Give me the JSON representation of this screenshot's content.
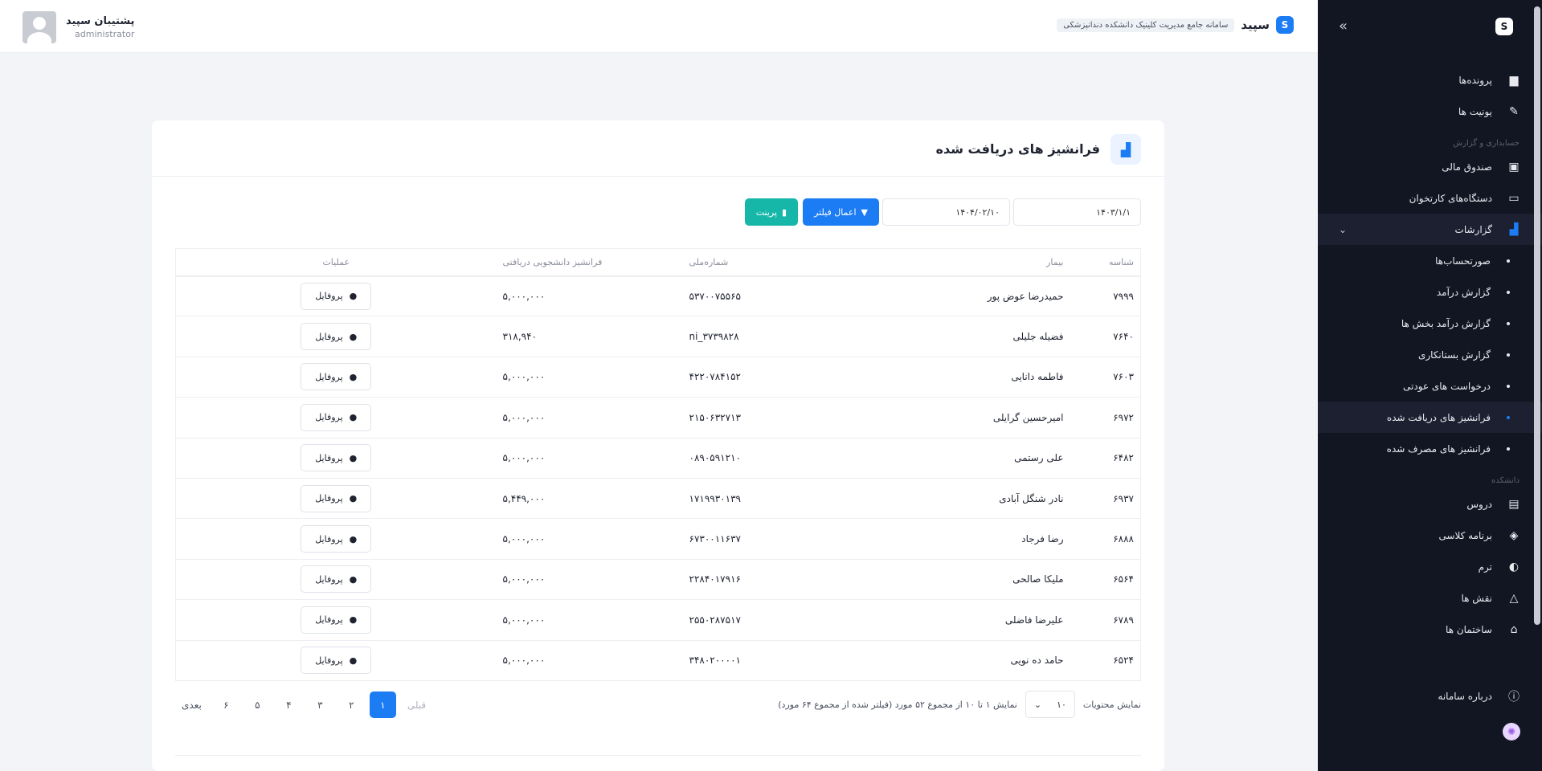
{
  "topbar": {
    "brand_name": "سپید",
    "brand_tag": "سامانه جامع مدیریت کلینیک دانشکده دندانپزشکی",
    "user_name": "پشتیبان سپید",
    "user_role": "administrator"
  },
  "sidebar": {
    "logo": "S",
    "collapse": "»",
    "items_top": [
      {
        "label": "پرونده‌ها",
        "icon": "folder-icon"
      },
      {
        "label": "یونیت ها",
        "icon": "tooth-tool-icon"
      }
    ],
    "section_accounting": "حسابداری و گزارش",
    "items_accounting": [
      {
        "label": "صندوق مالی",
        "icon": "cashbox-icon"
      },
      {
        "label": "دستگاه‌های کارتخوان",
        "icon": "card-icon"
      },
      {
        "label": "گزارشات",
        "icon": "chart-icon"
      }
    ],
    "sub_items": [
      {
        "label": "صورتحساب‌ها"
      },
      {
        "label": "گزارش درآمد"
      },
      {
        "label": "گزارش درآمد بخش ها"
      },
      {
        "label": "گزارش بستانکاری"
      },
      {
        "label": "درخواست های عودتی"
      },
      {
        "label": "فرانشیز های دریافت شده"
      },
      {
        "label": "فرانشیز های مصرف شده"
      }
    ],
    "section_university": "دانشکده",
    "items_university": [
      {
        "label": "دروس",
        "icon": "book-icon"
      },
      {
        "label": "برنامه کلاسی",
        "icon": "layers-icon"
      },
      {
        "label": "ترم",
        "icon": "toggle-icon"
      },
      {
        "label": "نقش ها",
        "icon": "shapes-icon"
      },
      {
        "label": "ساختمان ها",
        "icon": "building-icon"
      }
    ],
    "item_about": {
      "label": "درباره سامانه",
      "icon": "info-icon"
    }
  },
  "card": {
    "title": "فرانشیز های دریافت شده",
    "from_date": "۱۴۰۳/۱/۱",
    "to_date": "۱۴۰۴/۰۲/۱۰",
    "apply_filter": "اعمال فیلتر",
    "print": "پرینت"
  },
  "table": {
    "headers": {
      "id": "شناسه",
      "patient": "بیمار",
      "national_id": "شماره‌ملی",
      "franchise": "فرانشیز دانشجویی دریافتی",
      "actions": "عملیات"
    },
    "profile_label": "پروفایل",
    "rows": [
      {
        "id": "۷۹۹۹",
        "patient": "حمیدرضا عوض پور",
        "national_id": "۵۳۷۰۰۷۵۵۶۵",
        "franchise": "۵,۰۰۰,۰۰۰"
      },
      {
        "id": "۷۶۴۰",
        "patient": "فضیله جلیلی",
        "national_id": "ni_۳۷۳۹۸۲۸",
        "franchise": "۳۱۸,۹۴۰"
      },
      {
        "id": "۷۶۰۳",
        "patient": "فاطمه دانایی",
        "national_id": "۴۲۲۰۷۸۴۱۵۲",
        "franchise": "۵,۰۰۰,۰۰۰"
      },
      {
        "id": "۶۹۷۲",
        "patient": "امیرحسین گرایلی",
        "national_id": "۲۱۵۰۶۳۲۷۱۳",
        "franchise": "۵,۰۰۰,۰۰۰"
      },
      {
        "id": "۶۴۸۲",
        "patient": "علی رستمی",
        "national_id": "۰۸۹۰۵۹۱۲۱۰",
        "franchise": "۵,۰۰۰,۰۰۰"
      },
      {
        "id": "۶۹۳۷",
        "patient": "نادر شنگل آبادی",
        "national_id": "۱۷۱۹۹۳۰۱۳۹",
        "franchise": "۵,۴۴۹,۰۰۰"
      },
      {
        "id": "۶۸۸۸",
        "patient": "رضا فرجاد",
        "national_id": "۶۷۳۰۰۱۱۶۳۷",
        "franchise": "۵,۰۰۰,۰۰۰"
      },
      {
        "id": "۶۵۶۴",
        "patient": "ملیکا صالحی",
        "national_id": "۲۲۸۴۰۱۷۹۱۶",
        "franchise": "۵,۰۰۰,۰۰۰"
      },
      {
        "id": "۶۷۸۹",
        "patient": "علیرضا فاضلی",
        "national_id": "۲۵۵۰۲۸۷۵۱۷",
        "franchise": "۵,۰۰۰,۰۰۰"
      },
      {
        "id": "۶۵۲۴",
        "patient": "حامد ده نویی",
        "national_id": "۳۴۸۰۲۰۰۰۰۱",
        "franchise": "۵,۰۰۰,۰۰۰"
      }
    ]
  },
  "pagination": {
    "show_label": "نمایش محتویات",
    "page_size": "۱۰",
    "info": "نمایش ۱ تا ۱۰ از مجموع ۵۲ مورد (فیلتر شده از مجموع ۶۴ مورد)",
    "prev": "قبلی",
    "next": "بعدی",
    "pages": [
      "۱",
      "۲",
      "۳",
      "۴",
      "۵",
      "۶"
    ]
  },
  "colors": {
    "primary": "#1c7cf4",
    "teal": "#16b7a9",
    "sidebar_bg": "#121522"
  }
}
